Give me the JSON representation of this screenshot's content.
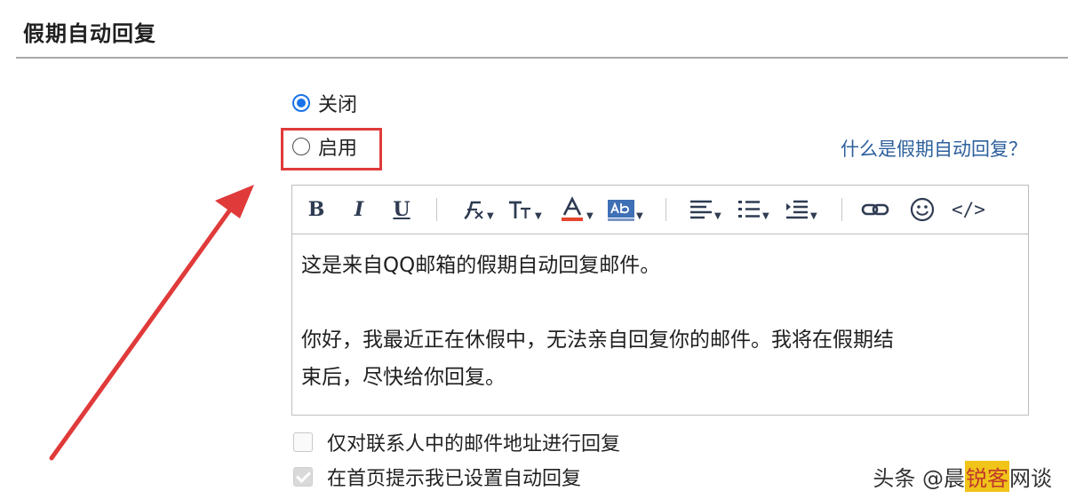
{
  "section": {
    "title": "假期自动回复"
  },
  "options": [
    {
      "label": "关闭",
      "checked": true
    },
    {
      "label": "启用",
      "checked": false
    }
  ],
  "help_link": "什么是假期自动回复？",
  "toolbar": {
    "bold": "B",
    "italic": "I",
    "underline": "U",
    "font_icon": "font-icon",
    "font_size_icon": "font-size-icon",
    "font_color_icon": "font-color-icon",
    "bg_color_icon": "background-color-icon",
    "align_icon": "align-icon",
    "list_icon": "list-icon",
    "indent_icon": "indent-icon",
    "link_icon": "link-icon",
    "emoji_icon": "emoji-icon",
    "code_label": "</>"
  },
  "editor": {
    "line1": "这是来自QQ邮箱的假期自动回复邮件。",
    "line2": "你好，我最近正在休假中，无法亲自回复你的邮件。我将在假期结",
    "line3": "束后，尽快给你回复。"
  },
  "checkboxes": [
    {
      "label": "仅对联系人中的邮件地址进行回复",
      "checked": false
    },
    {
      "label": "在首页提示我已设置自动回复",
      "checked": true
    }
  ],
  "watermark": {
    "prefix": "头条 @晨",
    "highlight": "锐客",
    "suffix": "网谈"
  },
  "colors": {
    "accent": "#1a73e8",
    "annotation_red": "#e03a3a",
    "link": "#2d5f9c",
    "font_color_bar": "#e4452c"
  }
}
